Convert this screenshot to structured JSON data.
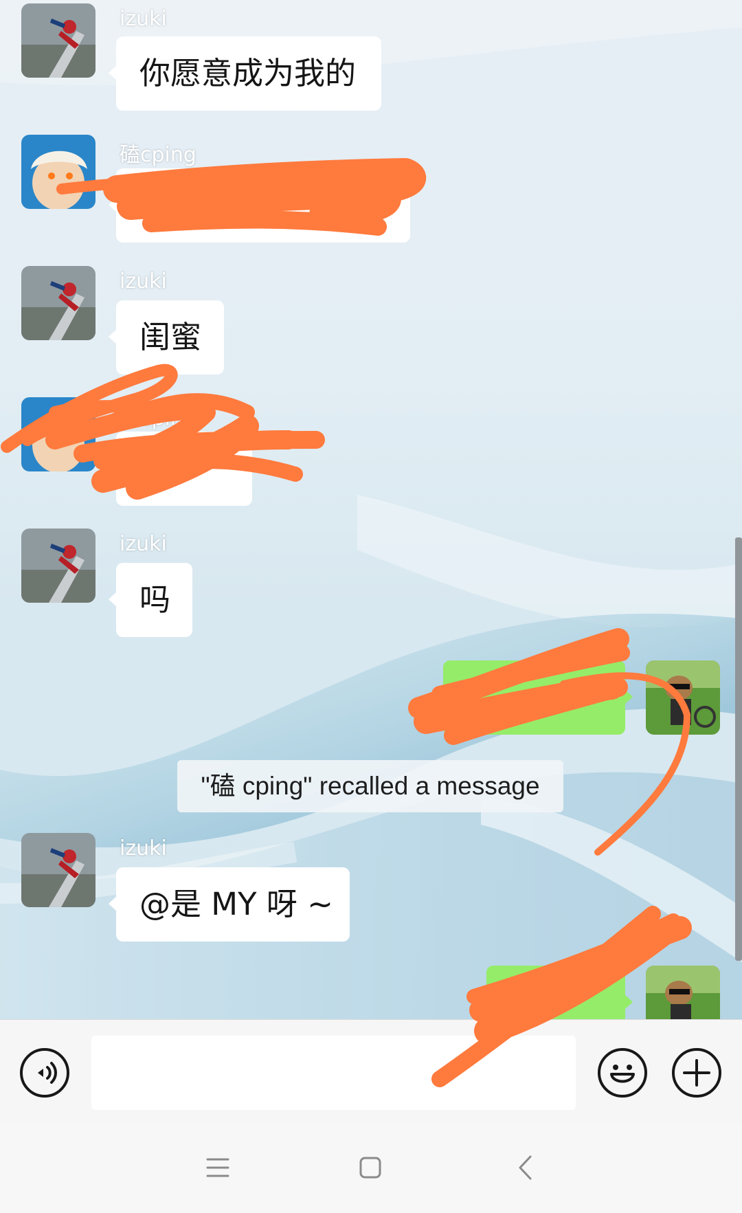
{
  "messages": [
    {
      "sender": "izuki",
      "text": "你愿意成为我的",
      "side": "left",
      "avatar": "spiderman-avatar"
    },
    {
      "sender": "磕cping",
      "text": "。",
      "side": "left",
      "avatar": "anime-avatar"
    },
    {
      "sender": "izuki",
      "text": "闺蜜",
      "side": "left",
      "avatar": "spiderman-avatar"
    },
    {
      "sender": "磕cping",
      "text": "",
      "side": "left",
      "avatar": "anime-avatar"
    },
    {
      "sender": "izuki",
      "text": "吗",
      "side": "left",
      "avatar": "spiderman-avatar"
    },
    {
      "sender": "",
      "text": "",
      "side": "right",
      "avatar": "dog-avatar"
    },
    {
      "sender": "izuki",
      "text": "@是 MY 呀 ~",
      "side": "left",
      "avatar": "spiderman-avatar"
    },
    {
      "sender": "",
      "text": "",
      "side": "right",
      "avatar": "dog-avatar"
    }
  ],
  "system_note": "\"磕 cping\" recalled a message",
  "input": {
    "value": "",
    "placeholder": ""
  },
  "icons": {
    "voice": "voice-icon",
    "emoji": "emoji-icon",
    "add": "plus-icon",
    "nav_menu": "menu-icon",
    "nav_home": "home-square-icon",
    "nav_back": "back-chevron-icon"
  },
  "colors": {
    "bubble_incoming": "#ffffff",
    "bubble_outgoing": "#95ec69",
    "scribble": "#ff7a3d"
  }
}
